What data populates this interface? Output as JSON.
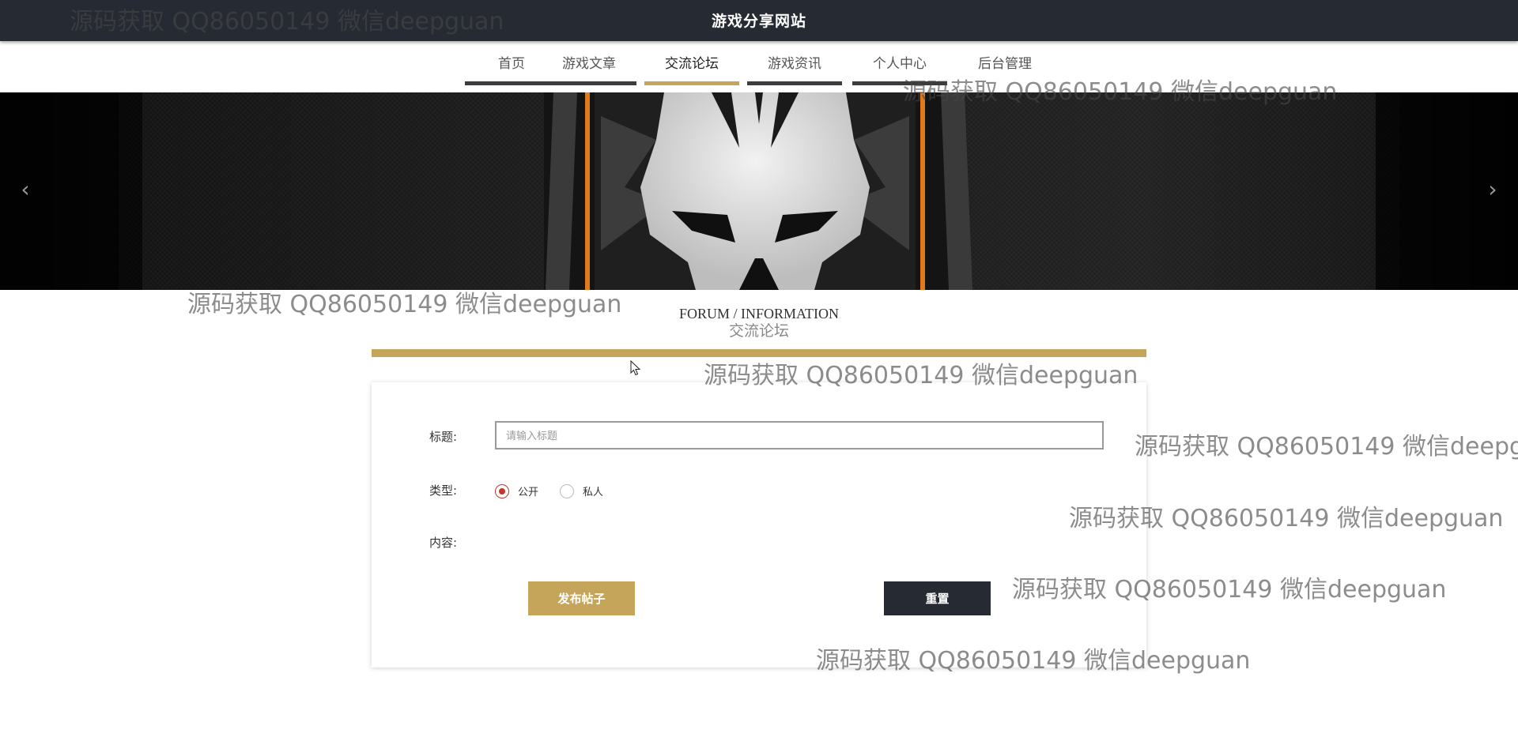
{
  "header": {
    "site_title": "游戏分享网站"
  },
  "nav": {
    "items": [
      {
        "label": "首页"
      },
      {
        "label": "游戏文章"
      },
      {
        "label": "交流论坛"
      },
      {
        "label": "游戏资讯"
      },
      {
        "label": "个人中心"
      },
      {
        "label": "后台管理"
      }
    ],
    "active_index": 2
  },
  "banner": {
    "prev_icon": "chevron-left-icon",
    "next_icon": "chevron-right-icon",
    "prev_glyph": "‹",
    "next_glyph": "›"
  },
  "section": {
    "title_en": "FORUM / INFORMATION",
    "title_cn": "交流论坛"
  },
  "form": {
    "title_label": "标题:",
    "title_placeholder": "请输入标题",
    "title_value": "",
    "type_label": "类型:",
    "type_options": [
      {
        "label": "公开",
        "checked": true
      },
      {
        "label": "私人",
        "checked": false
      }
    ],
    "content_label": "内容:",
    "submit_label": "发布帖子",
    "reset_label": "重置"
  },
  "watermark_text": "源码获取 QQ86050149 微信deepguan",
  "colors": {
    "topbar": "#262a33",
    "accent_gold": "#c5a55a",
    "nav_bar_dark": "#3a3c40",
    "radio_checked": "#c0392b"
  }
}
